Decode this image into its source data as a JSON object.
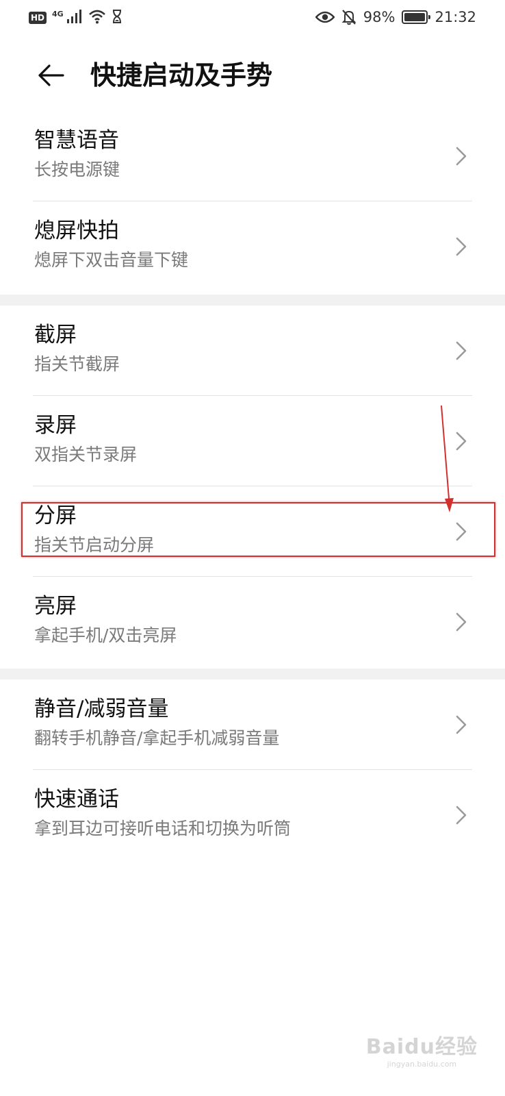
{
  "status_bar": {
    "hd_label": "HD",
    "network_label": "4G",
    "battery_percent_text": "98%",
    "battery_level": 0.98,
    "time": "21:32",
    "icons": [
      "signal-icon",
      "wifi-icon",
      "hourglass-icon",
      "eye-icon",
      "bell-off-icon",
      "battery-icon"
    ]
  },
  "header": {
    "title": "快捷启动及手势",
    "back_icon": "back-arrow-icon"
  },
  "groups": [
    {
      "items": [
        {
          "title": "智慧语音",
          "subtitle": "长按电源键"
        },
        {
          "title": "熄屏快拍",
          "subtitle": "熄屏下双击音量下键"
        }
      ]
    },
    {
      "items": [
        {
          "title": "截屏",
          "subtitle": "指关节截屏"
        },
        {
          "title": "录屏",
          "subtitle": "双指关节录屏"
        },
        {
          "title": "分屏",
          "subtitle": "指关节启动分屏"
        },
        {
          "title": "亮屏",
          "subtitle": "拿起手机/双击亮屏"
        }
      ]
    },
    {
      "items": [
        {
          "title": "静音/减弱音量",
          "subtitle": "翻转手机静音/拿起手机减弱音量"
        },
        {
          "title": "快速通话",
          "subtitle": "拿到耳边可接听电话和切换为听筒"
        }
      ]
    }
  ],
  "annotation": {
    "highlight_color": "#d32f2f"
  },
  "watermark": {
    "brand": "Baidu经验",
    "site": "jingyan.baidu.com"
  },
  "colors": {
    "background": "#ffffff",
    "group_gap": "#f1f1f1",
    "title_text": "#111111",
    "subtitle_text": "#7a7a7a",
    "divider": "#e3e3e3"
  }
}
